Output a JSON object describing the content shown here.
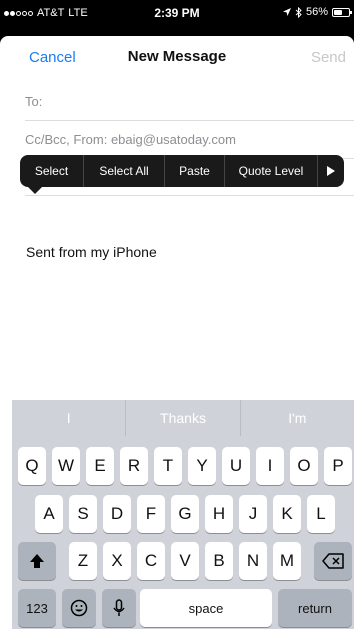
{
  "status_bar": {
    "carrier": "AT&T",
    "network": "LTE",
    "time": "2:39 PM",
    "battery": "56%",
    "battery_level": 0.56,
    "signal_bars_filled": 2,
    "signal_bars_total": 5
  },
  "nav": {
    "cancel": "Cancel",
    "title": "New Message",
    "send": "Send"
  },
  "fields": {
    "to_label": "To:",
    "cc_label": "Cc/Bcc, From:  ebaig@usatoday.com"
  },
  "edit_menu": {
    "items": [
      "Select",
      "Select All",
      "Paste",
      "Quote Level"
    ],
    "more_icon": "triangle-right-icon"
  },
  "body": {
    "signature": "Sent from my iPhone"
  },
  "keyboard": {
    "predictions": [
      "I",
      "Thanks",
      "I'm"
    ],
    "row1": [
      "Q",
      "W",
      "E",
      "R",
      "T",
      "Y",
      "U",
      "I",
      "O",
      "P"
    ],
    "row2": [
      "A",
      "S",
      "D",
      "F",
      "G",
      "H",
      "J",
      "K",
      "L"
    ],
    "row3": [
      "Z",
      "X",
      "C",
      "V",
      "B",
      "N",
      "M"
    ],
    "numbers_key": "123",
    "space_key": "space",
    "return_key": "return",
    "icons": {
      "shift": "shift-arrow-icon",
      "backspace": "backspace-icon",
      "emoji": "emoji-icon",
      "dictation": "microphone-icon"
    }
  },
  "colors": {
    "accent": "#1b7cf3",
    "disabled": "#c7c7cc",
    "keyboard_bg": "#cfd3d9"
  }
}
